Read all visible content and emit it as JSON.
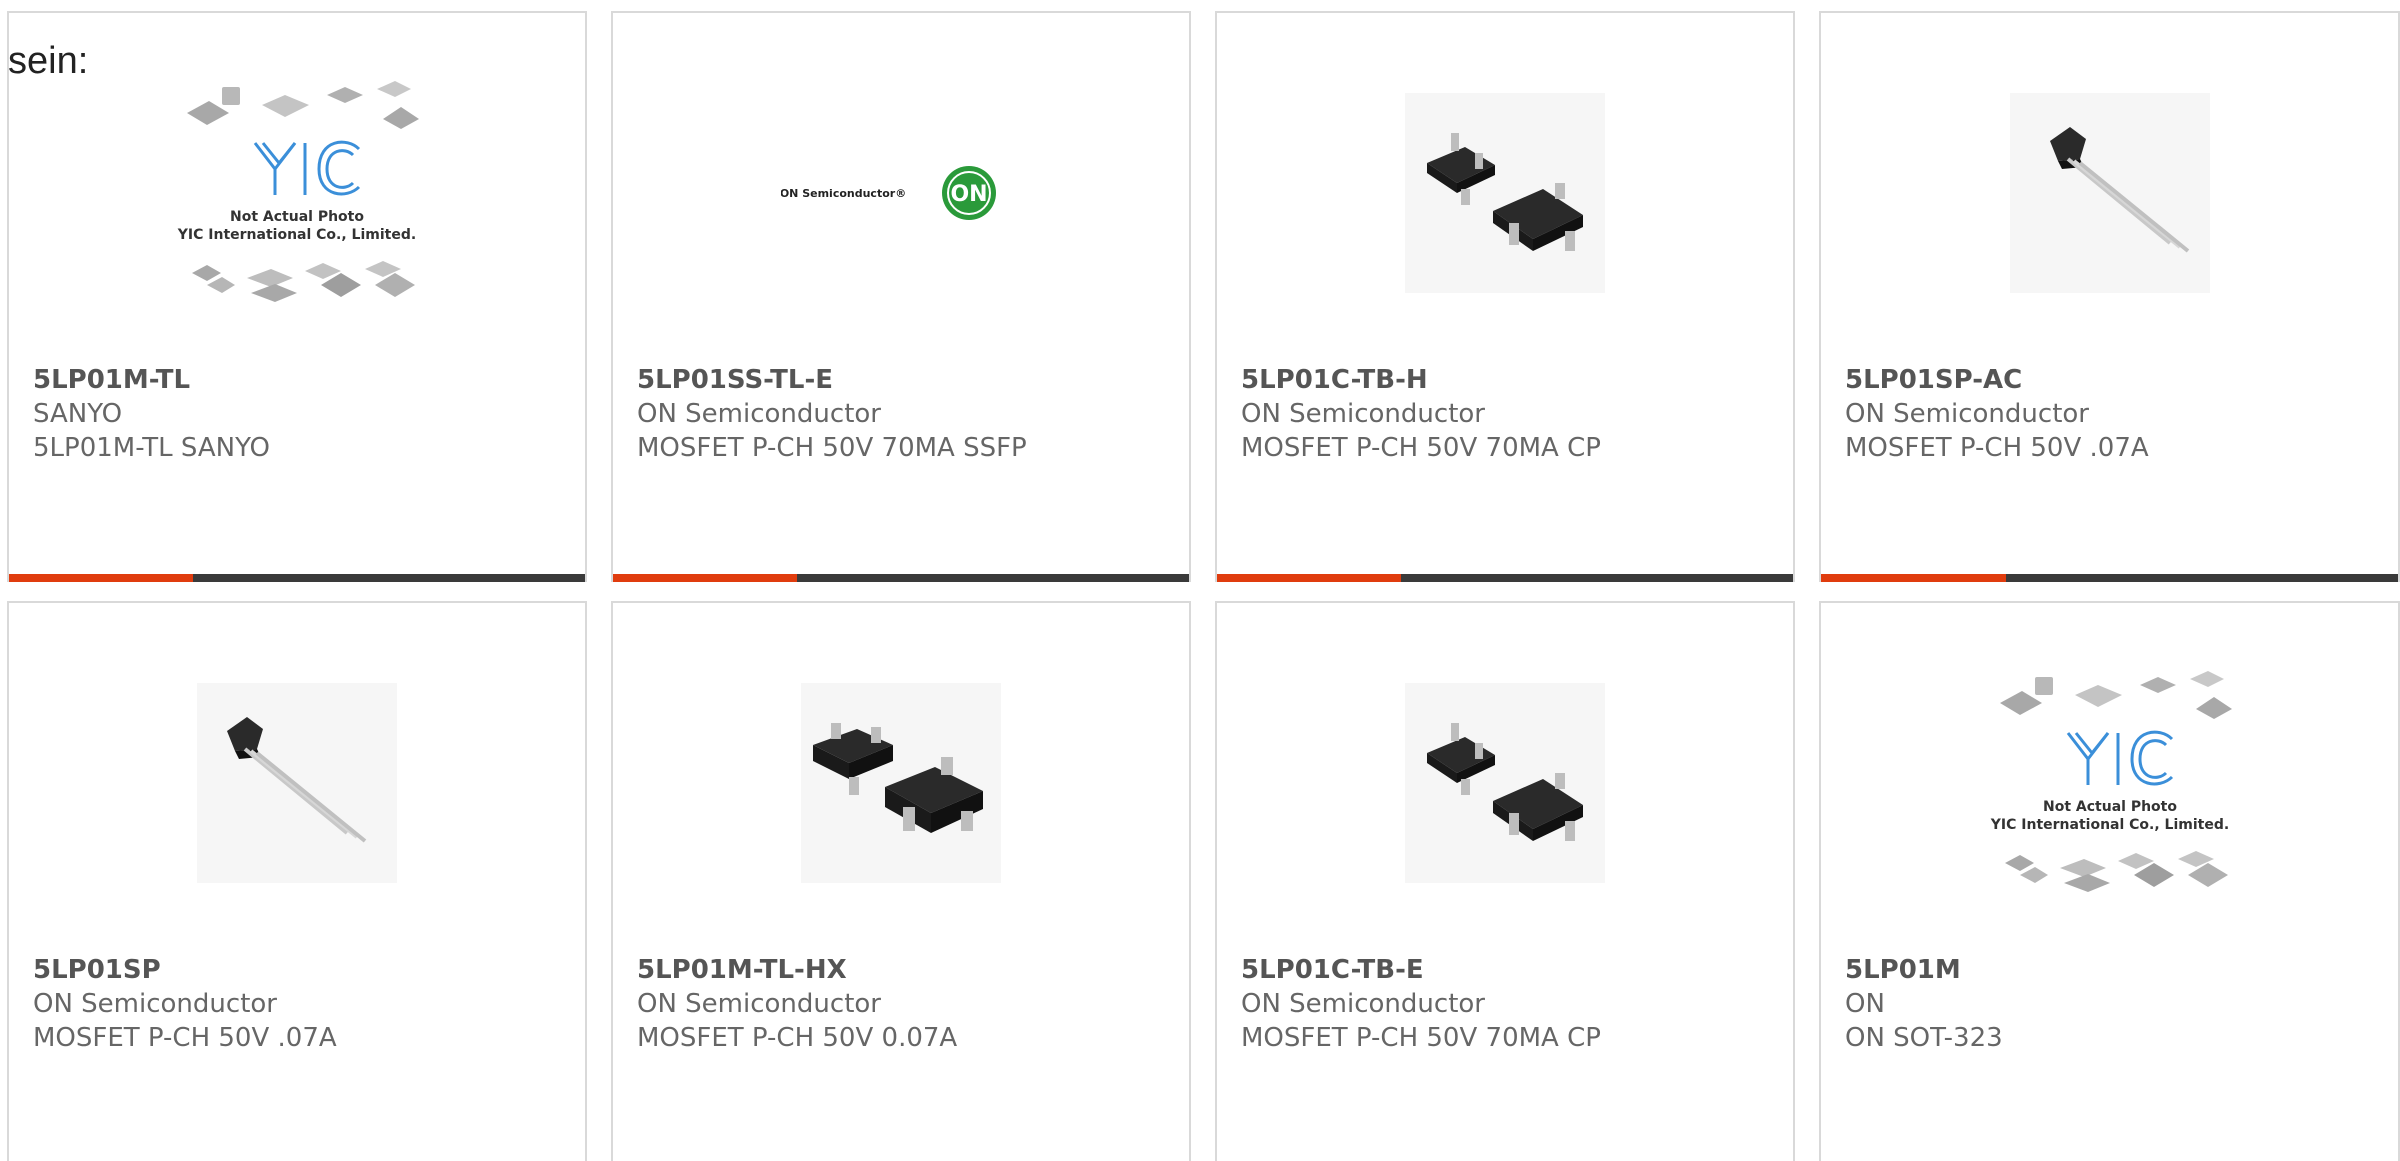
{
  "intro_text": "sein:",
  "colors": {
    "accent_bar": "#e03c0e",
    "dark_bar": "#3a3a3a",
    "card_border": "#d9d9d9",
    "on_logo_green": "#2a9a3a"
  },
  "products": [
    {
      "part_number": "5LP01M-TL",
      "manufacturer": "SANYO",
      "description": "5LP01M-TL SANYO",
      "image": "yic-placeholder",
      "placeholder_text": [
        "Not Actual Photo",
        "YIC International Co., Limited."
      ],
      "logo_text": "YIC"
    },
    {
      "part_number": "5LP01SS-TL-E",
      "manufacturer": "ON Semiconductor",
      "description": "MOSFET P-CH 50V 70MA SSFP",
      "image": "on-semiconductor-logo",
      "logo_wordmark": "ON Semiconductor®",
      "logo_badge": "ON"
    },
    {
      "part_number": "5LP01C-TB-H",
      "manufacturer": "ON Semiconductor",
      "description": "MOSFET P-CH 50V 70MA CP",
      "image": "sot23-pair"
    },
    {
      "part_number": "5LP01SP-AC",
      "manufacturer": "ON Semiconductor",
      "description": "MOSFET P-CH 50V .07A",
      "image": "to92-transistor"
    },
    {
      "part_number": "5LP01SP",
      "manufacturer": "ON Semiconductor",
      "description": "MOSFET P-CH 50V .07A",
      "image": "to92-transistor"
    },
    {
      "part_number": "5LP01M-TL-HX",
      "manufacturer": "ON Semiconductor",
      "description": "MOSFET P-CH 50V 0.07A",
      "image": "sot23-pair-large"
    },
    {
      "part_number": "5LP01C-TB-E",
      "manufacturer": "ON Semiconductor",
      "description": "MOSFET P-CH 50V 70MA CP",
      "image": "sot23-pair"
    },
    {
      "part_number": "5LP01M",
      "manufacturer": "ON",
      "description": "ON SOT-323",
      "image": "yic-placeholder",
      "placeholder_text": [
        "Not Actual Photo",
        "YIC International Co., Limited."
      ],
      "logo_text": "YIC"
    }
  ]
}
